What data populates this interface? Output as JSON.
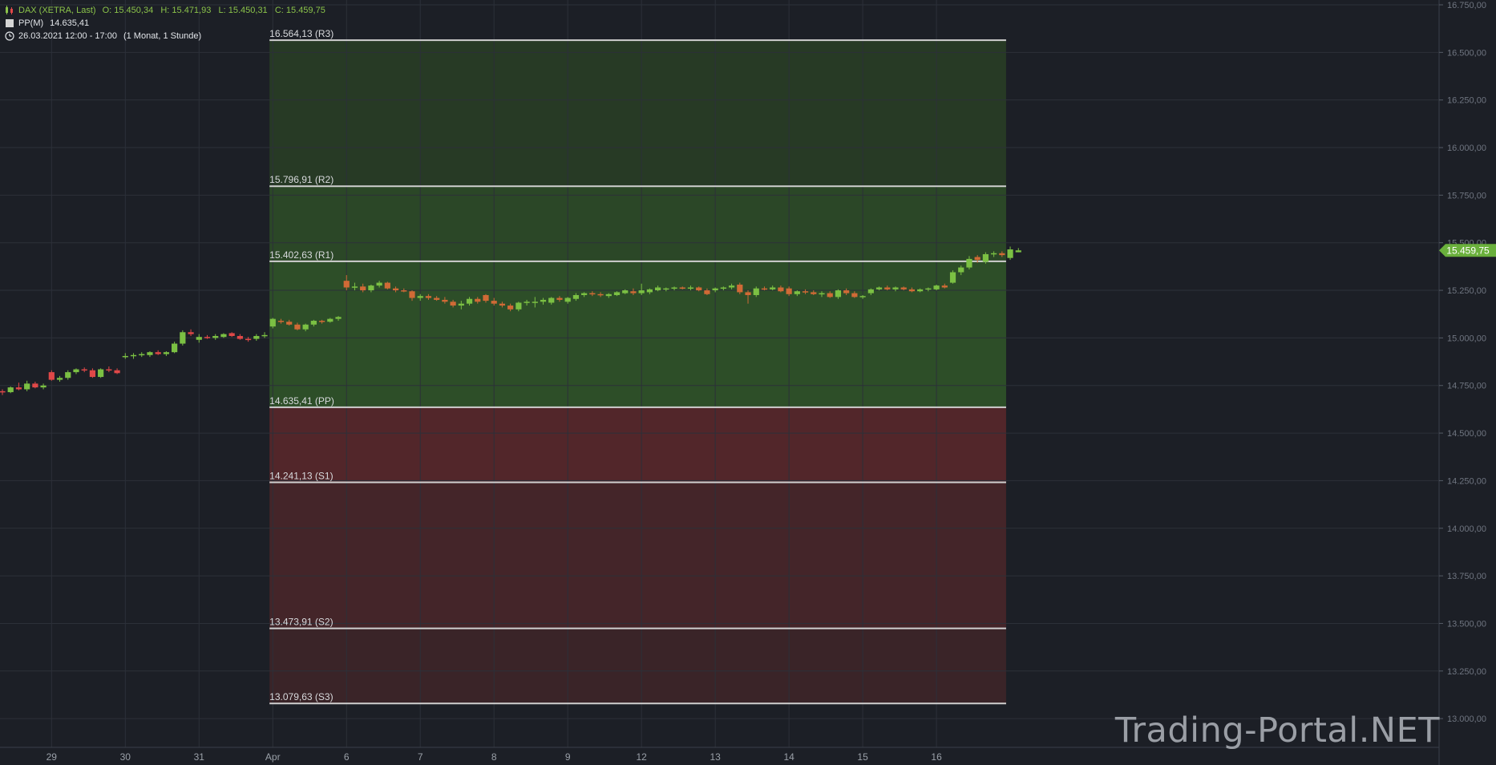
{
  "legend": {
    "instrument": "DAX (XETRA, Last)",
    "ohlc": "O: 15.450,34   H: 15.471,93   L: 15.450,31   C: 15.459,75",
    "indicator_name": "PP(M)",
    "indicator_value": "14.635,41",
    "time_range": "26.03.2021 12:00 - 17:00",
    "interval": "(1 Monat, 1 Stunde)"
  },
  "watermark": "Trading-Portal.NET",
  "colors": {
    "background": "#1c1f26",
    "up": "#7bc043",
    "down_red": "#e04848",
    "down_orange": "#d06a36",
    "zone_resistance": "#2c4a27",
    "zone_support": "#4a2326",
    "level_line": "#d0d0d0",
    "last_price_tag": "#6ab03c"
  },
  "chart_data": {
    "type": "candlestick",
    "title": "",
    "xlabel": "",
    "ylabel": "",
    "ylim": [
      12950,
      16750
    ],
    "grid": true,
    "last_price": 15459.75,
    "last_price_label": "15.459,75",
    "y_ticks": [
      {
        "value": 13000,
        "label": "13.000,00"
      },
      {
        "value": 13250,
        "label": "13.250,00"
      },
      {
        "value": 13500,
        "label": "13.500,00"
      },
      {
        "value": 13750,
        "label": "13.750,00"
      },
      {
        "value": 14000,
        "label": "14.000,00"
      },
      {
        "value": 14250,
        "label": "14.250,00"
      },
      {
        "value": 14500,
        "label": "14.500,00"
      },
      {
        "value": 14750,
        "label": "14.750,00"
      },
      {
        "value": 15000,
        "label": "15.000,00"
      },
      {
        "value": 15250,
        "label": "15.250,00"
      },
      {
        "value": 15500,
        "label": "15.500,00"
      },
      {
        "value": 15750,
        "label": "15.750,00"
      },
      {
        "value": 16000,
        "label": "16.000,00"
      },
      {
        "value": 16250,
        "label": "16.250,00"
      },
      {
        "value": 16500,
        "label": "16.500,00"
      },
      {
        "value": 16750,
        "label": "16.750,00"
      }
    ],
    "x_ticks": [
      {
        "label": "29",
        "bar": 6
      },
      {
        "label": "30",
        "bar": 15
      },
      {
        "label": "31",
        "bar": 24
      },
      {
        "label": "Apr",
        "bar": 33
      },
      {
        "label": "6",
        "bar": 42
      },
      {
        "label": "7",
        "bar": 51
      },
      {
        "label": "8",
        "bar": 60
      },
      {
        "label": "9",
        "bar": 69
      },
      {
        "label": "12",
        "bar": 78
      },
      {
        "label": "13",
        "bar": 87
      },
      {
        "label": "14",
        "bar": 96
      },
      {
        "label": "15",
        "bar": 105
      },
      {
        "label": "16",
        "bar": 114
      }
    ],
    "pivot_levels": [
      {
        "name": "R3",
        "value": 16564.13,
        "label": "16.564,13 (R3)"
      },
      {
        "name": "R2",
        "value": 15796.91,
        "label": "15.796,91 (R2)"
      },
      {
        "name": "R1",
        "value": 15402.63,
        "label": "15.402,63 (R1)"
      },
      {
        "name": "PP",
        "value": 14635.41,
        "label": "14.635,41 (PP)"
      },
      {
        "name": "S1",
        "value": 14241.13,
        "label": "14.241,13 (S1)"
      },
      {
        "name": "S2",
        "value": 13473.91,
        "label": "13.473,91 (S2)"
      },
      {
        "name": "S3",
        "value": 13079.63,
        "label": "13.079,63 (S3)"
      }
    ],
    "pivot_start_bar": 32.6,
    "pivot_end_bar": 122.5,
    "candles": [
      [
        14720,
        14730,
        14700,
        14715
      ],
      [
        14715,
        14745,
        14710,
        14740
      ],
      [
        14740,
        14765,
        14725,
        14730
      ],
      [
        14730,
        14775,
        14720,
        14760
      ],
      [
        14760,
        14770,
        14735,
        14740
      ],
      [
        14740,
        14760,
        14730,
        14750
      ],
      [
        14820,
        14830,
        14775,
        14780
      ],
      [
        14780,
        14800,
        14770,
        14790
      ],
      [
        14790,
        14830,
        14780,
        14820
      ],
      [
        14820,
        14840,
        14810,
        14835
      ],
      [
        14835,
        14845,
        14820,
        14830
      ],
      [
        14830,
        14840,
        14790,
        14795
      ],
      [
        14795,
        14840,
        14790,
        14835
      ],
      [
        14835,
        14850,
        14820,
        14830
      ],
      [
        14830,
        14840,
        14810,
        14815
      ],
      [
        14900,
        14920,
        14890,
        14905
      ],
      [
        14905,
        14920,
        14890,
        14910
      ],
      [
        14910,
        14925,
        14900,
        14915
      ],
      [
        14910,
        14930,
        14900,
        14925
      ],
      [
        14925,
        14935,
        14910,
        14915
      ],
      [
        14915,
        14930,
        14905,
        14925
      ],
      [
        14925,
        14980,
        14920,
        14970
      ],
      [
        14970,
        15040,
        14960,
        15030
      ],
      [
        15030,
        15045,
        15010,
        15020
      ],
      [
        14990,
        15020,
        14975,
        15005
      ],
      [
        15005,
        15015,
        14995,
        15000
      ],
      [
        15000,
        15020,
        14990,
        15010
      ],
      [
        15005,
        15025,
        15000,
        15020
      ],
      [
        15025,
        15030,
        15005,
        15010
      ],
      [
        15010,
        15020,
        14990,
        14995
      ],
      [
        14995,
        15005,
        14980,
        14990
      ],
      [
        14995,
        15020,
        14985,
        15010
      ],
      [
        15010,
        15030,
        15000,
        15015
      ],
      [
        15060,
        15105,
        15050,
        15100
      ],
      [
        15090,
        15100,
        15075,
        15085
      ],
      [
        15085,
        15095,
        15065,
        15070
      ],
      [
        15070,
        15080,
        15040,
        15045
      ],
      [
        15045,
        15075,
        15035,
        15070
      ],
      [
        15070,
        15095,
        15060,
        15090
      ],
      [
        15090,
        15095,
        15075,
        15085
      ],
      [
        15085,
        15105,
        15080,
        15100
      ],
      [
        15100,
        15115,
        15090,
        15110
      ],
      [
        15300,
        15330,
        15250,
        15265
      ],
      [
        15265,
        15290,
        15250,
        15270
      ],
      [
        15270,
        15285,
        15240,
        15250
      ],
      [
        15250,
        15280,
        15240,
        15275
      ],
      [
        15275,
        15300,
        15265,
        15290
      ],
      [
        15290,
        15295,
        15255,
        15260
      ],
      [
        15260,
        15270,
        15240,
        15250
      ],
      [
        15250,
        15260,
        15240,
        15245
      ],
      [
        15245,
        15250,
        15195,
        15210
      ],
      [
        15210,
        15230,
        15195,
        15220
      ],
      [
        15220,
        15230,
        15200,
        15210
      ],
      [
        15210,
        15220,
        15195,
        15200
      ],
      [
        15200,
        15215,
        15180,
        15190
      ],
      [
        15190,
        15200,
        15160,
        15170
      ],
      [
        15170,
        15195,
        15150,
        15180
      ],
      [
        15180,
        15215,
        15170,
        15205
      ],
      [
        15205,
        15215,
        15180,
        15190
      ],
      [
        15225,
        15230,
        15185,
        15195
      ],
      [
        15195,
        15210,
        15170,
        15180
      ],
      [
        15180,
        15190,
        15160,
        15170
      ],
      [
        15170,
        15180,
        15140,
        15150
      ],
      [
        15150,
        15190,
        15140,
        15185
      ],
      [
        15185,
        15200,
        15170,
        15190
      ],
      [
        15190,
        15215,
        15160,
        15190
      ],
      [
        15190,
        15210,
        15175,
        15200
      ],
      [
        15185,
        15215,
        15175,
        15210
      ],
      [
        15210,
        15220,
        15190,
        15200
      ],
      [
        15190,
        15215,
        15180,
        15210
      ],
      [
        15205,
        15235,
        15195,
        15225
      ],
      [
        15225,
        15240,
        15215,
        15235
      ],
      [
        15235,
        15245,
        15220,
        15230
      ],
      [
        15230,
        15240,
        15215,
        15225
      ],
      [
        15220,
        15235,
        15210,
        15230
      ],
      [
        15225,
        15245,
        15220,
        15240
      ],
      [
        15235,
        15255,
        15230,
        15250
      ],
      [
        15245,
        15260,
        15225,
        15235
      ],
      [
        15235,
        15285,
        15225,
        15250
      ],
      [
        15240,
        15260,
        15230,
        15255
      ],
      [
        15250,
        15275,
        15245,
        15265
      ],
      [
        15255,
        15265,
        15245,
        15260
      ],
      [
        15260,
        15270,
        15250,
        15265
      ],
      [
        15265,
        15270,
        15255,
        15260
      ],
      [
        15260,
        15275,
        15250,
        15265
      ],
      [
        15265,
        15270,
        15245,
        15250
      ],
      [
        15250,
        15260,
        15225,
        15230
      ],
      [
        15250,
        15265,
        15240,
        15260
      ],
      [
        15260,
        15270,
        15250,
        15265
      ],
      [
        15265,
        15285,
        15255,
        15275
      ],
      [
        15280,
        15290,
        15230,
        15240
      ],
      [
        15240,
        15250,
        15180,
        15225
      ],
      [
        15225,
        15270,
        15215,
        15260
      ],
      [
        15260,
        15270,
        15250,
        15255
      ],
      [
        15255,
        15275,
        15250,
        15265
      ],
      [
        15265,
        15275,
        15240,
        15245
      ],
      [
        15260,
        15270,
        15220,
        15230
      ],
      [
        15230,
        15250,
        15220,
        15245
      ],
      [
        15245,
        15255,
        15230,
        15240
      ],
      [
        15240,
        15250,
        15225,
        15230
      ],
      [
        15230,
        15245,
        15215,
        15235
      ],
      [
        15235,
        15245,
        15210,
        15215
      ],
      [
        15215,
        15255,
        15205,
        15250
      ],
      [
        15250,
        15260,
        15225,
        15235
      ],
      [
        15235,
        15245,
        15210,
        15215
      ],
      [
        15215,
        15225,
        15205,
        15220
      ],
      [
        15235,
        15260,
        15225,
        15255
      ],
      [
        15255,
        15270,
        15250,
        15265
      ],
      [
        15265,
        15275,
        15250,
        15255
      ],
      [
        15255,
        15270,
        15245,
        15265
      ],
      [
        15265,
        15270,
        15250,
        15255
      ],
      [
        15255,
        15265,
        15240,
        15245
      ],
      [
        15245,
        15260,
        15240,
        15255
      ],
      [
        15255,
        15265,
        15245,
        15260
      ],
      [
        15255,
        15280,
        15250,
        15275
      ],
      [
        15275,
        15285,
        15260,
        15265
      ],
      [
        15290,
        15355,
        15285,
        15345
      ],
      [
        15345,
        15380,
        15330,
        15370
      ],
      [
        15370,
        15430,
        15360,
        15415
      ],
      [
        15425,
        15435,
        15395,
        15410
      ],
      [
        15400,
        15450,
        15390,
        15440
      ],
      [
        15440,
        15455,
        15425,
        15445
      ],
      [
        15445,
        15455,
        15425,
        15435
      ],
      [
        15420,
        15480,
        15410,
        15465
      ],
      [
        15450,
        15472,
        15450,
        15460
      ]
    ]
  }
}
